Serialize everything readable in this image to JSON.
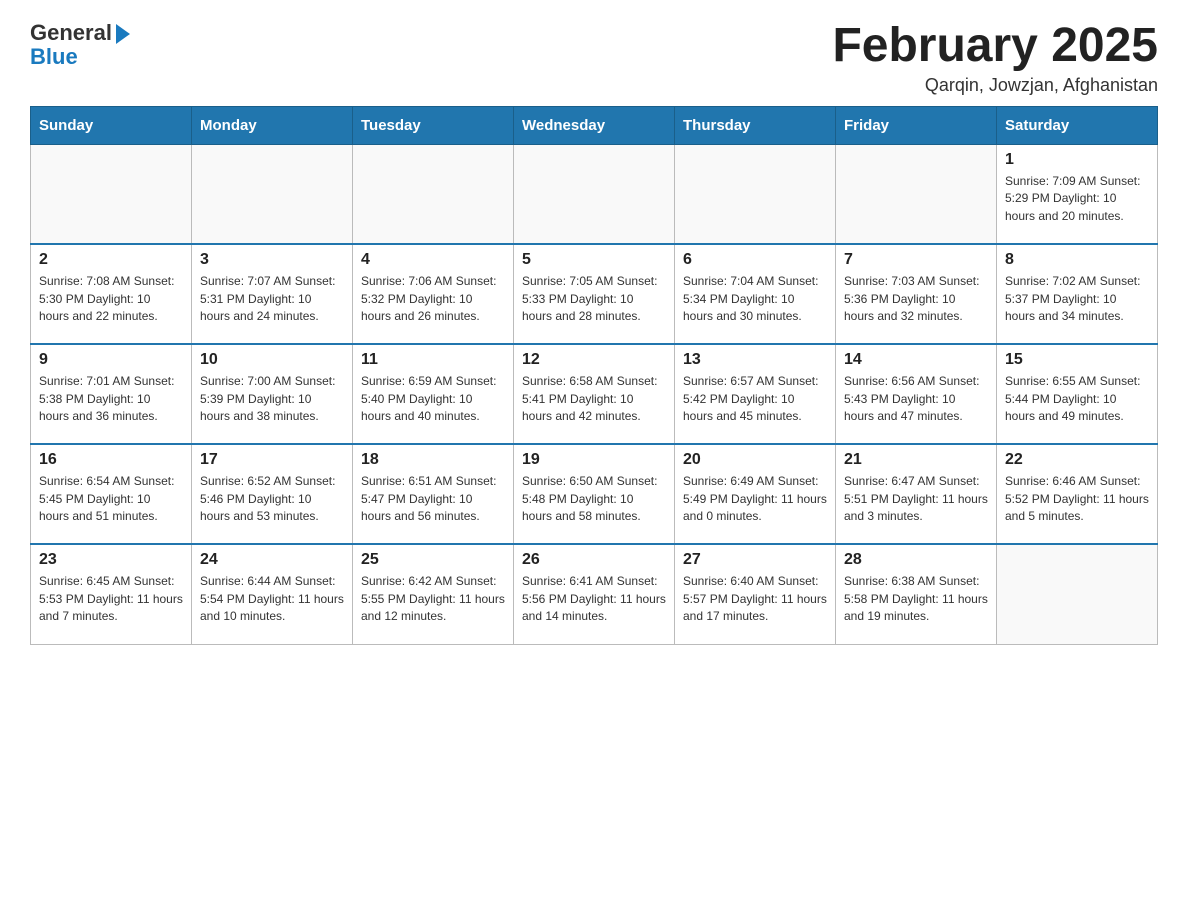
{
  "header": {
    "logo_general": "General",
    "logo_blue": "Blue",
    "month_title": "February 2025",
    "location": "Qarqin, Jowzjan, Afghanistan"
  },
  "calendar": {
    "days_of_week": [
      "Sunday",
      "Monday",
      "Tuesday",
      "Wednesday",
      "Thursday",
      "Friday",
      "Saturday"
    ],
    "weeks": [
      [
        {
          "day": "",
          "info": ""
        },
        {
          "day": "",
          "info": ""
        },
        {
          "day": "",
          "info": ""
        },
        {
          "day": "",
          "info": ""
        },
        {
          "day": "",
          "info": ""
        },
        {
          "day": "",
          "info": ""
        },
        {
          "day": "1",
          "info": "Sunrise: 7:09 AM\nSunset: 5:29 PM\nDaylight: 10 hours and 20 minutes."
        }
      ],
      [
        {
          "day": "2",
          "info": "Sunrise: 7:08 AM\nSunset: 5:30 PM\nDaylight: 10 hours and 22 minutes."
        },
        {
          "day": "3",
          "info": "Sunrise: 7:07 AM\nSunset: 5:31 PM\nDaylight: 10 hours and 24 minutes."
        },
        {
          "day": "4",
          "info": "Sunrise: 7:06 AM\nSunset: 5:32 PM\nDaylight: 10 hours and 26 minutes."
        },
        {
          "day": "5",
          "info": "Sunrise: 7:05 AM\nSunset: 5:33 PM\nDaylight: 10 hours and 28 minutes."
        },
        {
          "day": "6",
          "info": "Sunrise: 7:04 AM\nSunset: 5:34 PM\nDaylight: 10 hours and 30 minutes."
        },
        {
          "day": "7",
          "info": "Sunrise: 7:03 AM\nSunset: 5:36 PM\nDaylight: 10 hours and 32 minutes."
        },
        {
          "day": "8",
          "info": "Sunrise: 7:02 AM\nSunset: 5:37 PM\nDaylight: 10 hours and 34 minutes."
        }
      ],
      [
        {
          "day": "9",
          "info": "Sunrise: 7:01 AM\nSunset: 5:38 PM\nDaylight: 10 hours and 36 minutes."
        },
        {
          "day": "10",
          "info": "Sunrise: 7:00 AM\nSunset: 5:39 PM\nDaylight: 10 hours and 38 minutes."
        },
        {
          "day": "11",
          "info": "Sunrise: 6:59 AM\nSunset: 5:40 PM\nDaylight: 10 hours and 40 minutes."
        },
        {
          "day": "12",
          "info": "Sunrise: 6:58 AM\nSunset: 5:41 PM\nDaylight: 10 hours and 42 minutes."
        },
        {
          "day": "13",
          "info": "Sunrise: 6:57 AM\nSunset: 5:42 PM\nDaylight: 10 hours and 45 minutes."
        },
        {
          "day": "14",
          "info": "Sunrise: 6:56 AM\nSunset: 5:43 PM\nDaylight: 10 hours and 47 minutes."
        },
        {
          "day": "15",
          "info": "Sunrise: 6:55 AM\nSunset: 5:44 PM\nDaylight: 10 hours and 49 minutes."
        }
      ],
      [
        {
          "day": "16",
          "info": "Sunrise: 6:54 AM\nSunset: 5:45 PM\nDaylight: 10 hours and 51 minutes."
        },
        {
          "day": "17",
          "info": "Sunrise: 6:52 AM\nSunset: 5:46 PM\nDaylight: 10 hours and 53 minutes."
        },
        {
          "day": "18",
          "info": "Sunrise: 6:51 AM\nSunset: 5:47 PM\nDaylight: 10 hours and 56 minutes."
        },
        {
          "day": "19",
          "info": "Sunrise: 6:50 AM\nSunset: 5:48 PM\nDaylight: 10 hours and 58 minutes."
        },
        {
          "day": "20",
          "info": "Sunrise: 6:49 AM\nSunset: 5:49 PM\nDaylight: 11 hours and 0 minutes."
        },
        {
          "day": "21",
          "info": "Sunrise: 6:47 AM\nSunset: 5:51 PM\nDaylight: 11 hours and 3 minutes."
        },
        {
          "day": "22",
          "info": "Sunrise: 6:46 AM\nSunset: 5:52 PM\nDaylight: 11 hours and 5 minutes."
        }
      ],
      [
        {
          "day": "23",
          "info": "Sunrise: 6:45 AM\nSunset: 5:53 PM\nDaylight: 11 hours and 7 minutes."
        },
        {
          "day": "24",
          "info": "Sunrise: 6:44 AM\nSunset: 5:54 PM\nDaylight: 11 hours and 10 minutes."
        },
        {
          "day": "25",
          "info": "Sunrise: 6:42 AM\nSunset: 5:55 PM\nDaylight: 11 hours and 12 minutes."
        },
        {
          "day": "26",
          "info": "Sunrise: 6:41 AM\nSunset: 5:56 PM\nDaylight: 11 hours and 14 minutes."
        },
        {
          "day": "27",
          "info": "Sunrise: 6:40 AM\nSunset: 5:57 PM\nDaylight: 11 hours and 17 minutes."
        },
        {
          "day": "28",
          "info": "Sunrise: 6:38 AM\nSunset: 5:58 PM\nDaylight: 11 hours and 19 minutes."
        },
        {
          "day": "",
          "info": ""
        }
      ]
    ]
  }
}
